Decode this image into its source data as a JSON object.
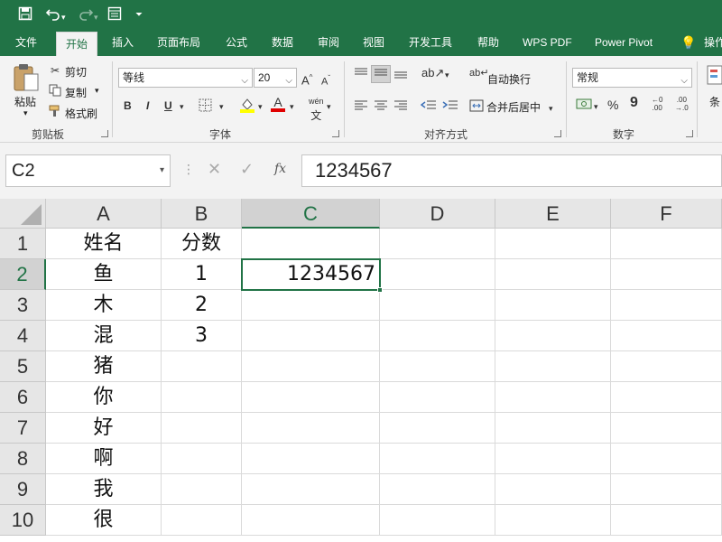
{
  "titlebar": {
    "icons": [
      "save-icon",
      "undo-icon",
      "redo-icon",
      "form-icon",
      "customize-icon"
    ]
  },
  "ribbon_tabs": [
    {
      "label": "文件"
    },
    {
      "label": "开始"
    },
    {
      "label": "插入"
    },
    {
      "label": "页面布局"
    },
    {
      "label": "公式"
    },
    {
      "label": "数据"
    },
    {
      "label": "审阅"
    },
    {
      "label": "视图"
    },
    {
      "label": "开发工具"
    },
    {
      "label": "帮助"
    },
    {
      "label": "WPS PDF"
    },
    {
      "label": "Power Pivot"
    },
    {
      "label": "操作"
    }
  ],
  "active_tab": "开始",
  "clipboard": {
    "paste": "粘贴",
    "cut": "剪切",
    "copy": "复制",
    "format_painter": "格式刷",
    "group": "剪贴板"
  },
  "font": {
    "name": "等线",
    "size": "20",
    "bold": "B",
    "italic": "I",
    "underline": "U",
    "grow": "A",
    "shrink": "A",
    "font_color_glyph": "A",
    "phonetic": "wén",
    "group": "字体"
  },
  "alignment": {
    "wrap_text": "自动换行",
    "merge_center": "合并后居中",
    "group": "对齐方式"
  },
  "number": {
    "format": "常规",
    "percent": "%",
    "comma": "9",
    "group": "数字"
  },
  "cond": {
    "label": "条"
  },
  "formula_bar": {
    "name_box": "C2",
    "fx": "fx",
    "value": "1234567"
  },
  "sheet": {
    "columns": [
      "A",
      "B",
      "C",
      "D",
      "E",
      "F"
    ],
    "rows": [
      "1",
      "2",
      "3",
      "4",
      "5",
      "6",
      "7",
      "8",
      "9",
      "10"
    ],
    "cells": {
      "A": [
        "姓名",
        "鱼",
        "木",
        "混",
        "猪",
        "你",
        "好",
        "啊",
        "我",
        "很"
      ],
      "B": [
        "分数",
        "1",
        "2",
        "3",
        "",
        "",
        "",
        "",
        "",
        ""
      ],
      "C": [
        "",
        "1234567",
        "",
        "",
        "",
        "",
        "",
        "",
        "",
        ""
      ]
    },
    "selected_cell": "C2",
    "accent": "#217346"
  }
}
